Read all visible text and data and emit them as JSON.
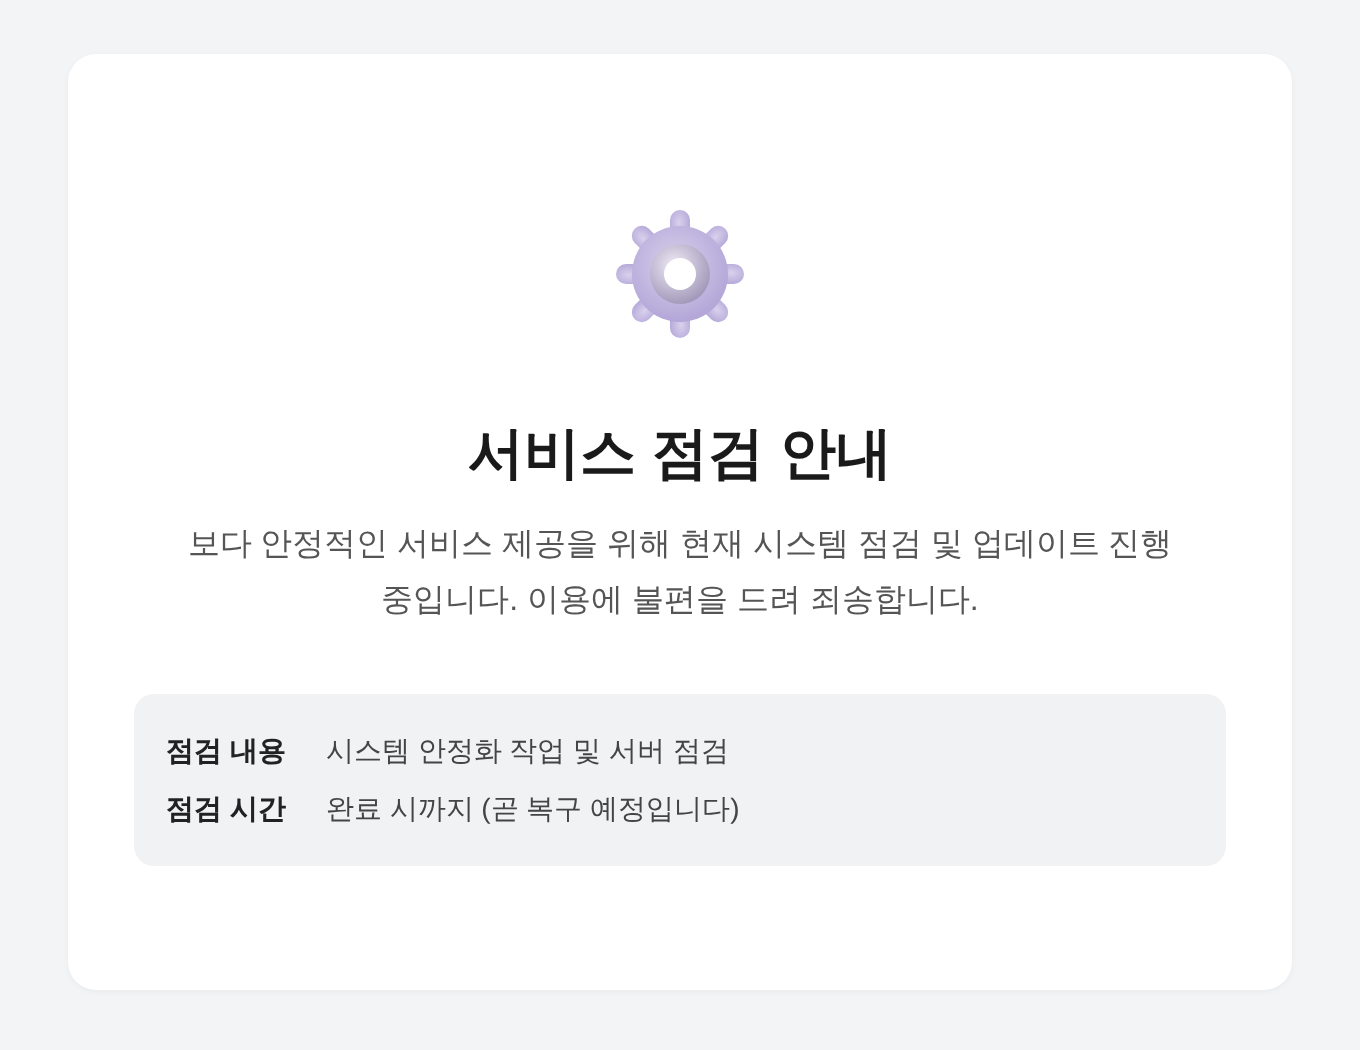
{
  "title": "서비스 점검 안내",
  "description": "보다 안정적인 서비스 제공을 위해 현재 시스템 점검 및 업데이트 진행 중입니다. 이용에 불편을 드려 죄송합니다.",
  "details": [
    {
      "label": "점검 내용",
      "value": "시스템 안정화 작업 및 서버 점검"
    },
    {
      "label": "점검 시간",
      "value": "완료 시까지 (곧 복구 예정입니다)"
    }
  ]
}
